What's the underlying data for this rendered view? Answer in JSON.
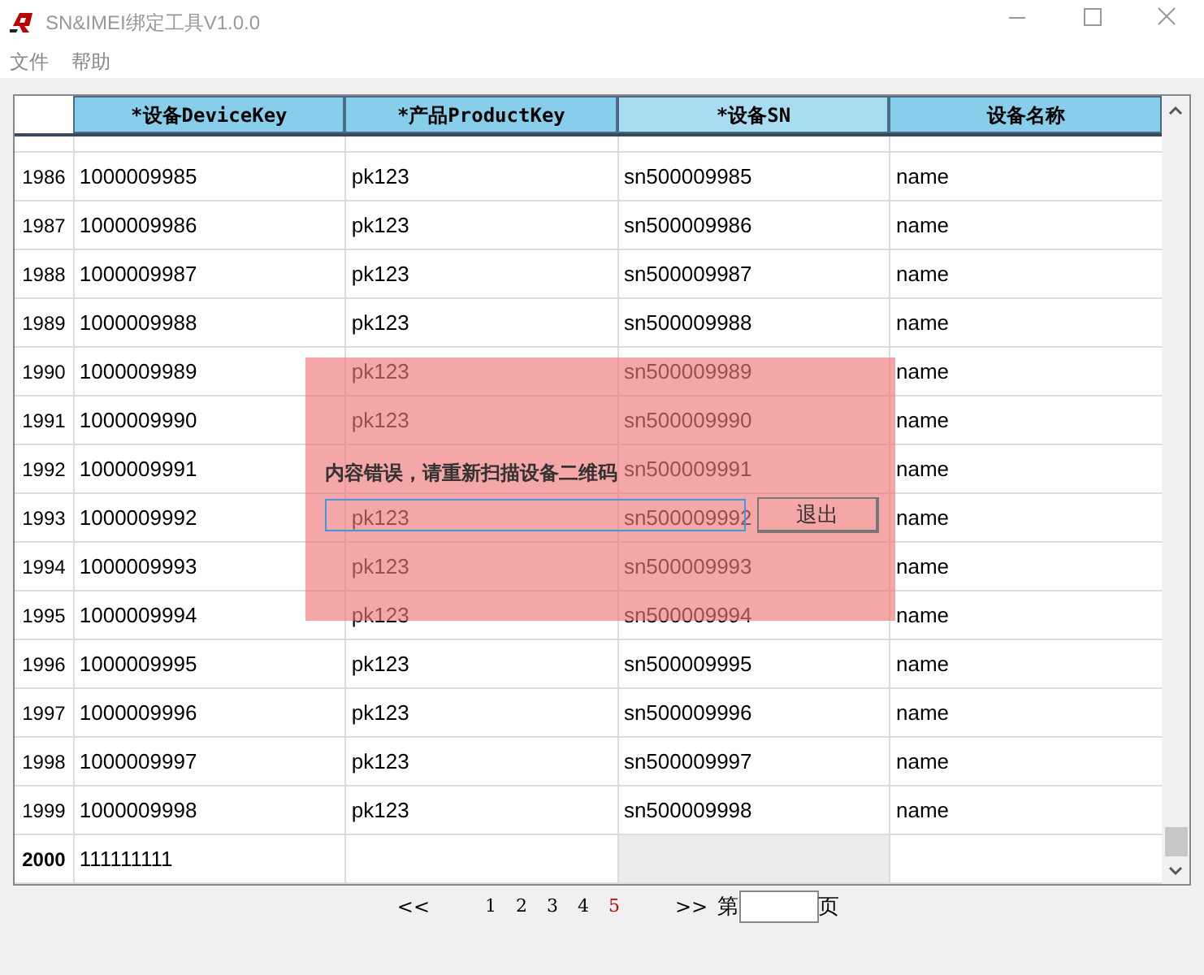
{
  "window": {
    "title": "SN&IMEI绑定工具V1.0.0"
  },
  "menu": [
    "文件",
    "帮助"
  ],
  "table": {
    "columns": [
      {
        "label": "*设备DeviceKey",
        "selected": false
      },
      {
        "label": "*产品ProductKey",
        "selected": false
      },
      {
        "label": "*设备SN",
        "selected": true
      },
      {
        "label": "设备名称",
        "selected": false
      }
    ],
    "rows": [
      {
        "number": "1986",
        "cells": [
          "1000009985",
          "pk123",
          "sn500009985",
          "name"
        ],
        "selected": false
      },
      {
        "number": "1987",
        "cells": [
          "1000009986",
          "pk123",
          "sn500009986",
          "name"
        ],
        "selected": false
      },
      {
        "number": "1988",
        "cells": [
          "1000009987",
          "pk123",
          "sn500009987",
          "name"
        ],
        "selected": false
      },
      {
        "number": "1989",
        "cells": [
          "1000009988",
          "pk123",
          "sn500009988",
          "name"
        ],
        "selected": false
      },
      {
        "number": "1990",
        "cells": [
          "1000009989",
          "pk123",
          "sn500009989",
          "name"
        ],
        "selected": false
      },
      {
        "number": "1991",
        "cells": [
          "1000009990",
          "pk123",
          "sn500009990",
          "name"
        ],
        "selected": false
      },
      {
        "number": "1992",
        "cells": [
          "1000009991",
          "",
          "sn500009991",
          "name"
        ],
        "selected": false
      },
      {
        "number": "1993",
        "cells": [
          "1000009992",
          "pk123",
          "sn500009992",
          "name"
        ],
        "selected": false
      },
      {
        "number": "1994",
        "cells": [
          "1000009993",
          "pk123",
          "sn500009993",
          "name"
        ],
        "selected": false
      },
      {
        "number": "1995",
        "cells": [
          "1000009994",
          "pk123",
          "sn500009994",
          "name"
        ],
        "selected": false
      },
      {
        "number": "1996",
        "cells": [
          "1000009995",
          "pk123",
          "sn500009995",
          "name"
        ],
        "selected": false
      },
      {
        "number": "1997",
        "cells": [
          "1000009996",
          "pk123",
          "sn500009996",
          "name"
        ],
        "selected": false
      },
      {
        "number": "1998",
        "cells": [
          "1000009997",
          "pk123",
          "sn500009997",
          "name"
        ],
        "selected": false
      },
      {
        "number": "1999",
        "cells": [
          "1000009998",
          "pk123",
          "sn500009998",
          "name"
        ],
        "selected": false
      },
      {
        "number": "2000",
        "cells": [
          "111111111",
          "",
          "",
          ""
        ],
        "selected": true
      }
    ]
  },
  "pager": {
    "first": "<<",
    "pages": [
      {
        "label": "1",
        "selected": false
      },
      {
        "label": "2",
        "selected": false
      },
      {
        "label": "3",
        "selected": false
      },
      {
        "label": "4",
        "selected": false
      },
      {
        "label": "5",
        "selected": true
      }
    ],
    "last": ">>",
    "prefix": "第",
    "suffix": "页"
  },
  "dialog": {
    "message": "内容错误，请重新扫描设备二维码",
    "button": "退出"
  }
}
